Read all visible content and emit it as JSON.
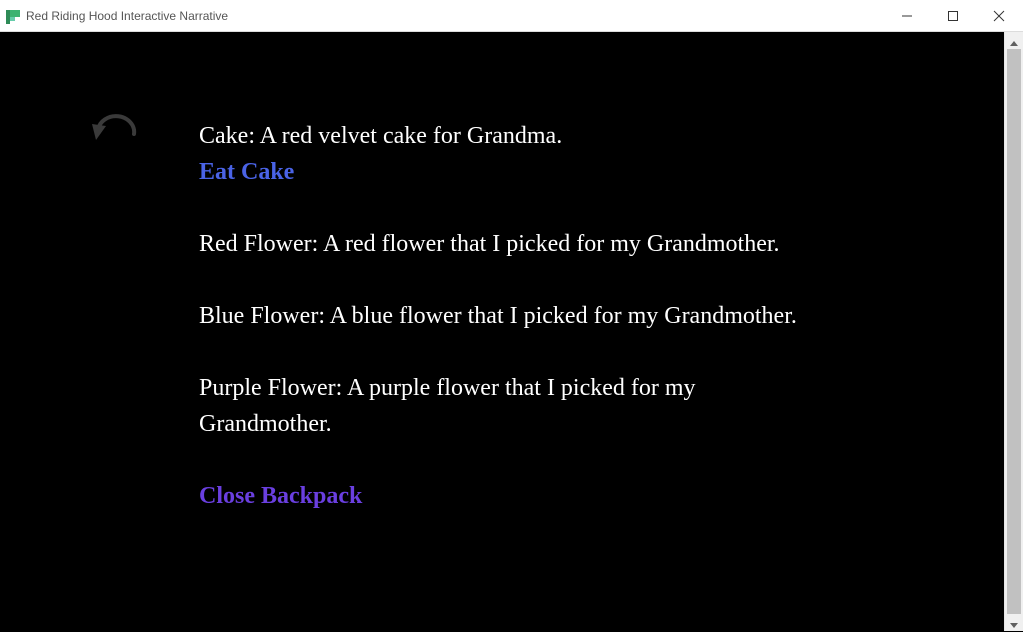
{
  "window": {
    "title": "Red Riding Hood Interactive Narrative",
    "icon": "app-logo-icon"
  },
  "controls": {
    "undo_icon": "undo-icon",
    "minimize_icon": "minimize-icon",
    "maximize_icon": "maximize-icon",
    "close_icon": "close-icon"
  },
  "items": [
    {
      "text": "Cake: A red velvet cake for Grandma.",
      "action": "Eat Cake"
    },
    {
      "text": "Red Flower: A red flower that I picked for my Grandmother."
    },
    {
      "text": "Blue Flower: A blue flower that I picked for my Grandmother."
    },
    {
      "text": "Purple Flower: A purple flower that I picked for my Grandmother."
    }
  ],
  "close_link": "Close Backpack",
  "colors": {
    "background": "#000000",
    "text": "#ffffff",
    "link": "#4a63e6",
    "close_link": "#6a3fe0"
  }
}
